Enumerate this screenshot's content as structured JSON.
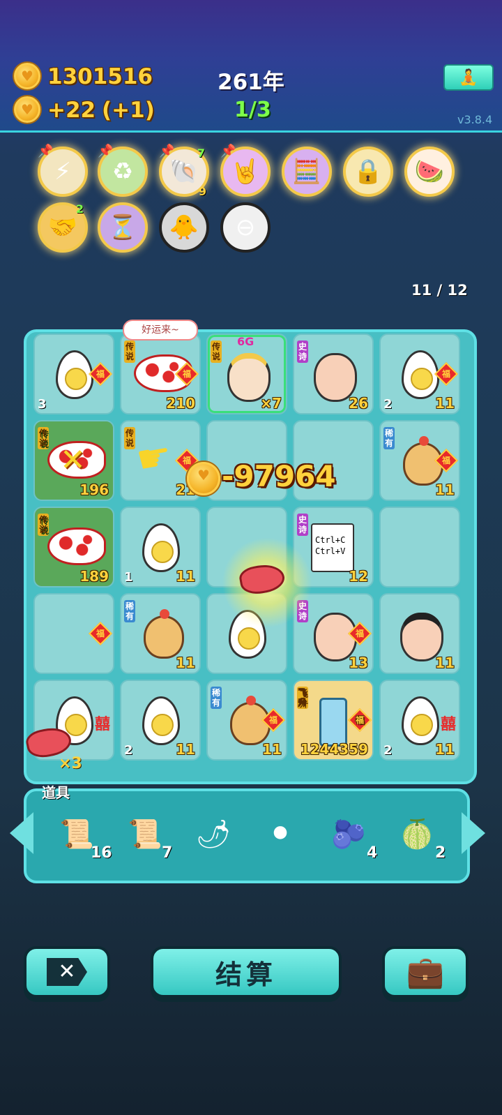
{
  "header": {
    "coins": "1301516",
    "income": "+22",
    "income_bonus": "(+1)",
    "year": "261年",
    "progress": "1/3",
    "version": "v3.8.4",
    "yoga_icon": "meditation-icon"
  },
  "relics": [
    {
      "name": "lightning",
      "icon": "⚡",
      "pinned": true
    },
    {
      "name": "recycle",
      "icon": "♻",
      "pinned": true
    },
    {
      "name": "shell",
      "icon": "🐚",
      "pinned": true,
      "badge_top": "7",
      "badge_bottom": "9"
    },
    {
      "name": "rock-hand",
      "icon": "🤘",
      "pinned": true
    },
    {
      "name": "math-brain",
      "icon": "🧮"
    },
    {
      "name": "safe",
      "icon": "🔒"
    },
    {
      "name": "fruit-basket",
      "icon": "🍉"
    },
    {
      "name": "handshake",
      "icon": "🤝",
      "badge_top": "2"
    },
    {
      "name": "hourglass-eggs",
      "icon": "⏳"
    },
    {
      "name": "chick-egg",
      "icon": "🐥"
    },
    {
      "name": "minus-coin",
      "icon": "⊖"
    }
  ],
  "counter": "11 / 12",
  "bubble": "好运来~",
  "loss": "-97964",
  "times3": "×3",
  "board": {
    "rows": [
      [
        {
          "type": "egg",
          "left": "3",
          "fu": true
        },
        {
          "type": "fish",
          "tag": "传说",
          "tagc": "legend",
          "right": "210",
          "fu": true
        },
        {
          "type": "king",
          "tag": "传说",
          "tagc": "legend",
          "right": "×7",
          "top": "6G"
        },
        {
          "type": "face",
          "tag": "史诗",
          "tagc": "epic",
          "right": "26"
        },
        {
          "type": "egg",
          "left": "2",
          "right": "11",
          "fu": true
        }
      ],
      [
        {
          "type": "fish-x",
          "tag": "传说",
          "tagc": "legend",
          "right": "196",
          "green": true
        },
        {
          "type": "empty",
          "tag": "传说",
          "tagc": "legend",
          "right": "21",
          "fu": true
        },
        {
          "type": "empty"
        },
        {
          "type": "empty"
        },
        {
          "type": "chick",
          "tag": "稀有",
          "tagc": "rare",
          "right": "11",
          "fu": true
        }
      ],
      [
        {
          "type": "fish",
          "tag": "传说",
          "tagc": "legend",
          "right": "189",
          "green": true
        },
        {
          "type": "egg",
          "left": "1",
          "right": "11"
        },
        {
          "type": "empty"
        },
        {
          "type": "copy",
          "tag": "史诗",
          "tagc": "epic",
          "right": "12",
          "line1": "Ctrl+C",
          "line2": "Ctrl+V"
        },
        {
          "type": "empty"
        }
      ],
      [
        {
          "type": "empty",
          "fu": true
        },
        {
          "type": "chick",
          "tag": "稀有",
          "tagc": "rare",
          "right": "11"
        },
        {
          "type": "egg"
        },
        {
          "type": "face",
          "tag": "史诗",
          "tagc": "epic",
          "right": "13",
          "fu": true
        },
        {
          "type": "face2",
          "right": "11"
        }
      ],
      [
        {
          "type": "egg",
          "xi": true
        },
        {
          "type": "egg",
          "left": "2",
          "right": "11"
        },
        {
          "type": "chick",
          "tag": "稀有",
          "tagc": "rare",
          "right": "11",
          "fu": true
        },
        {
          "type": "fridge",
          "tag": "飞升",
          "tagc": "fly",
          "right": "1244359",
          "gold": true,
          "fu": true
        },
        {
          "type": "egg",
          "left": "2",
          "right": "11",
          "xi": true
        }
      ]
    ]
  },
  "items_title": "道具",
  "items": [
    {
      "name": "scroll-set-a",
      "icon": "📜",
      "count": "16"
    },
    {
      "name": "scroll-set-b",
      "icon": "📜",
      "count": "7"
    },
    {
      "name": "pepper",
      "icon": "🌶",
      "count": ""
    },
    {
      "name": "black-hole",
      "icon": "⚫",
      "count": ""
    },
    {
      "name": "blueberry",
      "icon": "🫐",
      "count": "4"
    },
    {
      "name": "melon",
      "icon": "🍈",
      "count": "2"
    }
  ],
  "buttons": {
    "left_icon": "delete-icon",
    "center_label": "结算",
    "right_icon": "briefcase-icon"
  },
  "fu_char": "福",
  "xi_char": "囍"
}
